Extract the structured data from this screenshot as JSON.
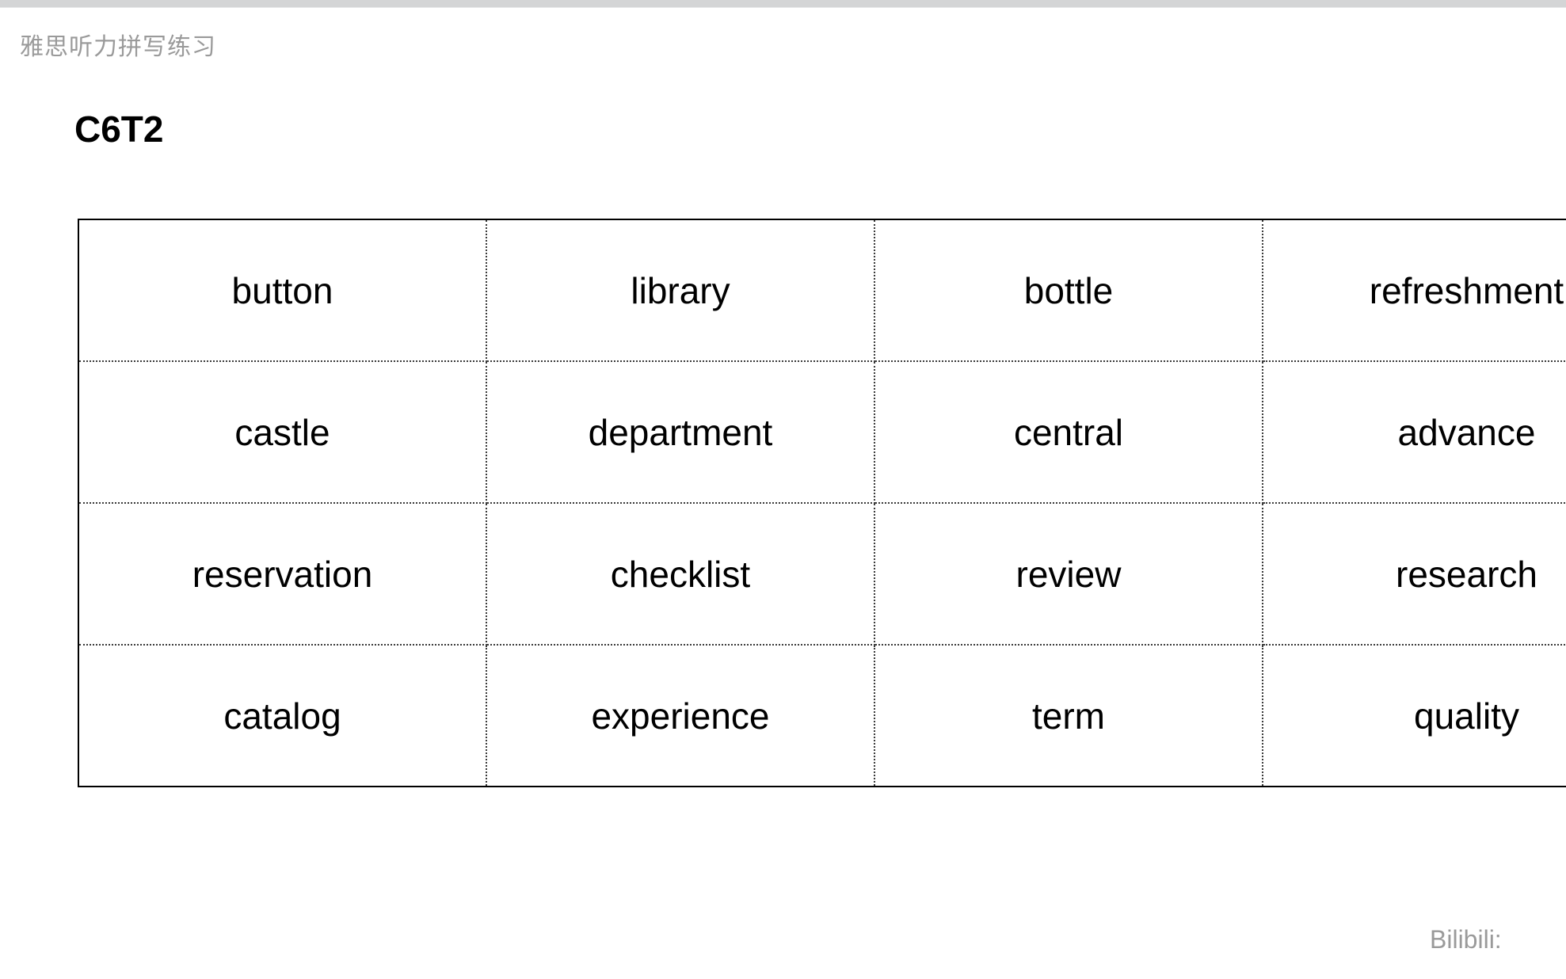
{
  "app": {
    "header_title": "雅思听力拼写练习"
  },
  "section": {
    "title": "C6T2"
  },
  "table": {
    "rows": [
      [
        "button",
        "library",
        "bottle",
        "refreshment"
      ],
      [
        "castle",
        "department",
        "central",
        "advance"
      ],
      [
        "reservation",
        "checklist",
        "review",
        "research"
      ],
      [
        "catalog",
        "experience",
        "term",
        "quality"
      ]
    ]
  },
  "watermark": {
    "text": "Bilibili:"
  },
  "colors": {
    "top_bar": "#d4d5d6",
    "header_text": "#9a9a9a",
    "title_text": "#000000",
    "cell_text": "#000000",
    "table_border": "#000000",
    "table_inner_border": "#3a3a3a",
    "background": "#ffffff"
  }
}
